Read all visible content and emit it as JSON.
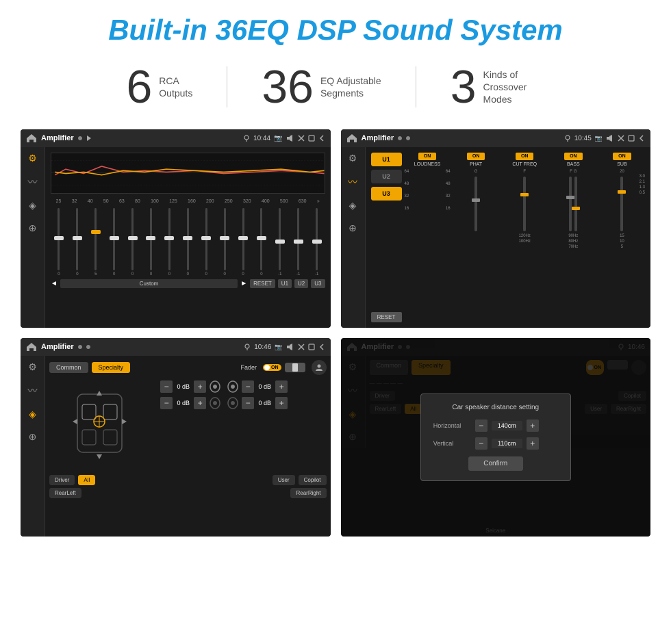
{
  "title": "Built-in 36EQ DSP Sound System",
  "stats": [
    {
      "number": "6",
      "label": "RCA\nOutputs"
    },
    {
      "number": "36",
      "label": "EQ Adjustable\nSegments"
    },
    {
      "number": "3",
      "label": "Kinds of\nCrossover Modes"
    }
  ],
  "screenshots": [
    {
      "id": "eq-screen",
      "statusBar": {
        "title": "Amplifier",
        "time": "10:44"
      },
      "type": "eq"
    },
    {
      "id": "crossover-screen",
      "statusBar": {
        "title": "Amplifier",
        "time": "10:45"
      },
      "type": "crossover"
    },
    {
      "id": "fader-screen",
      "statusBar": {
        "title": "Amplifier",
        "time": "10:46"
      },
      "type": "fader"
    },
    {
      "id": "distance-screen",
      "statusBar": {
        "title": "Amplifier",
        "time": "10:46"
      },
      "type": "distance"
    }
  ],
  "eq": {
    "frequencies": [
      "25",
      "32",
      "40",
      "50",
      "63",
      "80",
      "100",
      "125",
      "160",
      "200",
      "250",
      "320",
      "400",
      "500",
      "630"
    ],
    "sliderPositions": [
      50,
      50,
      45,
      55,
      50,
      40,
      55,
      50,
      48,
      52,
      50,
      50,
      45,
      46,
      47
    ],
    "values": [
      "0",
      "0",
      "5",
      "0",
      "0",
      "0",
      "0",
      "0",
      "0",
      "0",
      "0",
      "0",
      "-1",
      "-1"
    ],
    "presets": [
      "Custom",
      "RESET",
      "U1",
      "U2",
      "U3"
    ]
  },
  "crossover": {
    "units": [
      "U1",
      "U2",
      "U3"
    ],
    "channels": [
      "LOUDNESS",
      "PHAT",
      "CUT FREQ",
      "BASS",
      "SUB"
    ]
  },
  "fader": {
    "buttons": [
      "Common",
      "Specialty"
    ],
    "fadrLabel": "Fader",
    "speakerLabels": [
      "0 dB",
      "0 dB",
      "0 dB",
      "0 dB"
    ],
    "bottomButtons": [
      "Driver",
      "RearLeft",
      "All",
      "User",
      "RearRight",
      "Copilot"
    ]
  },
  "dialog": {
    "title": "Car speaker distance setting",
    "horizontal": {
      "label": "Horizontal",
      "value": "140cm"
    },
    "vertical": {
      "label": "Vertical",
      "value": "110cm"
    },
    "confirmLabel": "Confirm"
  },
  "watermark": "Seicane"
}
